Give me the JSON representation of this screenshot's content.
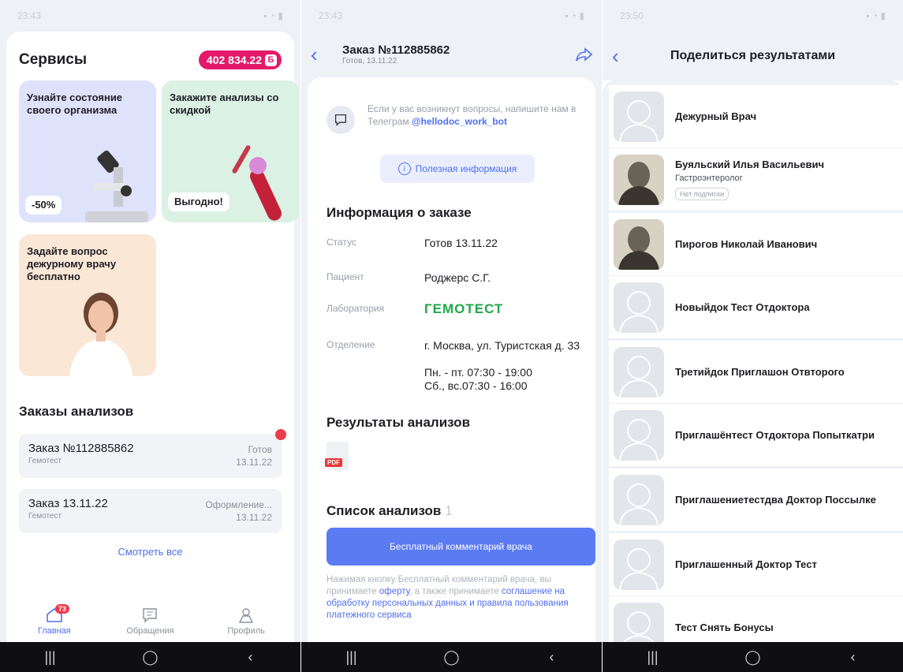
{
  "screen1": {
    "time": "23:43",
    "title": "Сервисы",
    "bonus": "402 834.22",
    "bonus_icon": "Б",
    "cards": {
      "state_title": "Узнайте состояние своего организма",
      "state_badge": "-50%",
      "discount_title": "Закажите анализы со скидкой",
      "discount_badge": "Выгодно!",
      "doctor_title": "Задайте вопрос дежурному врачу бесплатно"
    },
    "orders_title": "Заказы анализов",
    "orders": [
      {
        "title": "Заказ №112885862",
        "lab": "Гемотест",
        "status": "Готов",
        "date": "13.11.22"
      },
      {
        "title": "Заказ 13.11.22",
        "lab": "Гемотест",
        "status": "Оформление...",
        "date": "13.11.22"
      }
    ],
    "see_all": "Смотреть все",
    "tabs": {
      "home": "Главная",
      "home_badge": "73",
      "requests": "Обращения",
      "profile": "Профиль"
    }
  },
  "screen2": {
    "time": "23:43",
    "order_title": "Заказ №112885862",
    "order_sub": "Готов, 13.11.22",
    "help_text": "Если у вас возникнут вопросы, напишите нам в Телеграм",
    "help_link": "@hellodoc_work_bot",
    "useful_info": "Полезная информация",
    "info_title": "Информация о заказе",
    "status_label": "Статус",
    "status_value": "Готов 13.11.22",
    "patient_label": "Пациент",
    "patient_value": "Роджерс С.Г.",
    "lab_label": "Лаборатория",
    "lab_value": "ГЕМОТЕСТ",
    "branch_label": "Отделение",
    "branch_value": "г. Москва, ул. Туристская д. 33",
    "hours_line1": "Пн. - пт. 07:30 - 19:00",
    "hours_line2": "Сб., вс.07:30 - 16:00",
    "results_title": "Результаты анализов",
    "pdf_label": "PDF",
    "list_title": "Список анализов",
    "list_count": "1",
    "cta": "Бесплатный комментарий врача",
    "legal_1": "Нажимая кнопку Бесплатный комментарий врача, вы принимаете",
    "legal_offer": "оферту",
    "legal_2": ", а также принимаете",
    "legal_agree": "соглашение на обработку персональных данных и правила пользования платежного сервиса"
  },
  "screen3": {
    "time": "23:50",
    "title": "Поделиться результатами",
    "people": [
      {
        "name": "Дежурный Врач",
        "spec": "",
        "badge": ""
      },
      {
        "name": "Буяльский Илья Васильевич",
        "spec": "Гастроэнтеролог",
        "badge": "Нет подписки"
      },
      {
        "name": "Пирогов Николай Иванович",
        "spec": "",
        "badge": ""
      },
      {
        "name": "Новыйдок Тест Отдоктора",
        "spec": "",
        "badge": ""
      },
      {
        "name": "Третийдок Приглашон Отвторого",
        "spec": "",
        "badge": ""
      },
      {
        "name": "Приглашёнтест Отдоктора Попыткатри",
        "spec": "",
        "badge": ""
      },
      {
        "name": "Приглашениетестдва Доктор Поссылке",
        "spec": "",
        "badge": ""
      },
      {
        "name": "Приглашенный Доктор Тест",
        "spec": "",
        "badge": ""
      },
      {
        "name": "Тест Снять Бонусы",
        "spec": "",
        "badge": ""
      }
    ]
  },
  "colors": {
    "accent": "#4f6ff0",
    "bonus": "#e4196a",
    "lab_brand": "#1ea846"
  }
}
